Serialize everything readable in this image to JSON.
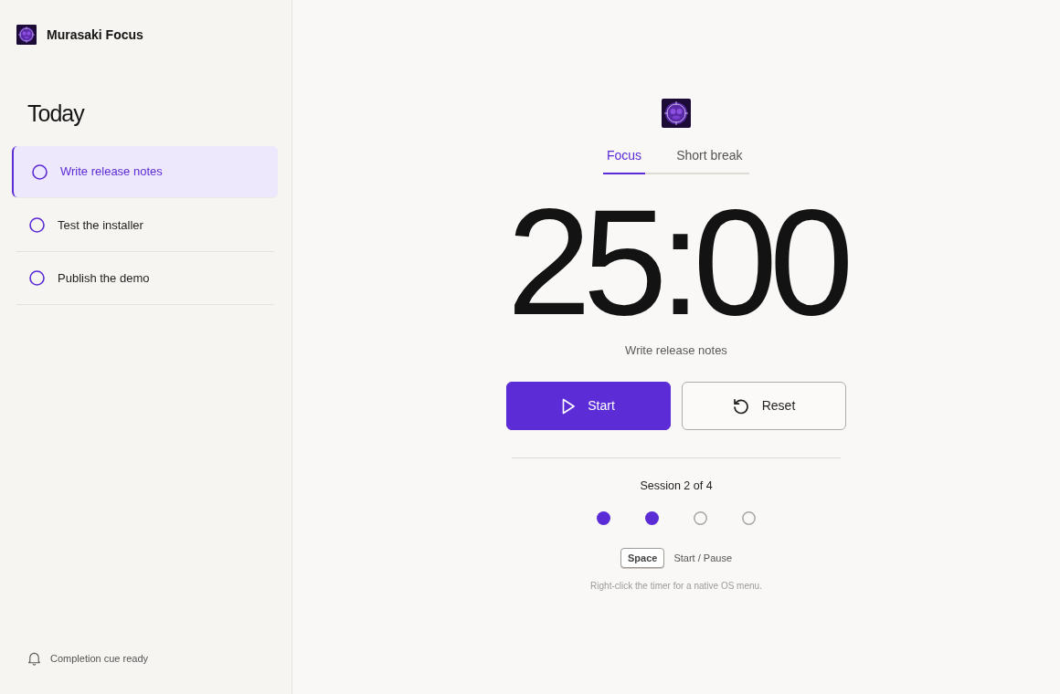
{
  "app": {
    "title": "Murasaki Focus"
  },
  "sidebar": {
    "heading": "Today",
    "tasks": [
      {
        "label": "Write release notes",
        "selected": true,
        "checked": false
      },
      {
        "label": "Test the installer",
        "selected": false,
        "checked": false
      },
      {
        "label": "Publish the demo",
        "selected": false,
        "checked": false
      }
    ],
    "status": "Completion cue ready"
  },
  "timer": {
    "tabs": [
      {
        "label": "Focus",
        "selected": true
      },
      {
        "label": "Short break",
        "selected": false
      }
    ],
    "time": "25:00",
    "task": "Write release notes",
    "buttons": [
      {
        "kind": "start",
        "label": "Start"
      },
      {
        "kind": "reset",
        "label": "Reset"
      }
    ],
    "session": "Session 2 of 4",
    "sessions": [
      {
        "done": true
      },
      {
        "done": true
      },
      {
        "done": false
      },
      {
        "done": false
      }
    ],
    "shortcut": {
      "key": "Space",
      "action": "Start / Pause"
    },
    "hint": "Right-click the timer for a native OS menu."
  }
}
